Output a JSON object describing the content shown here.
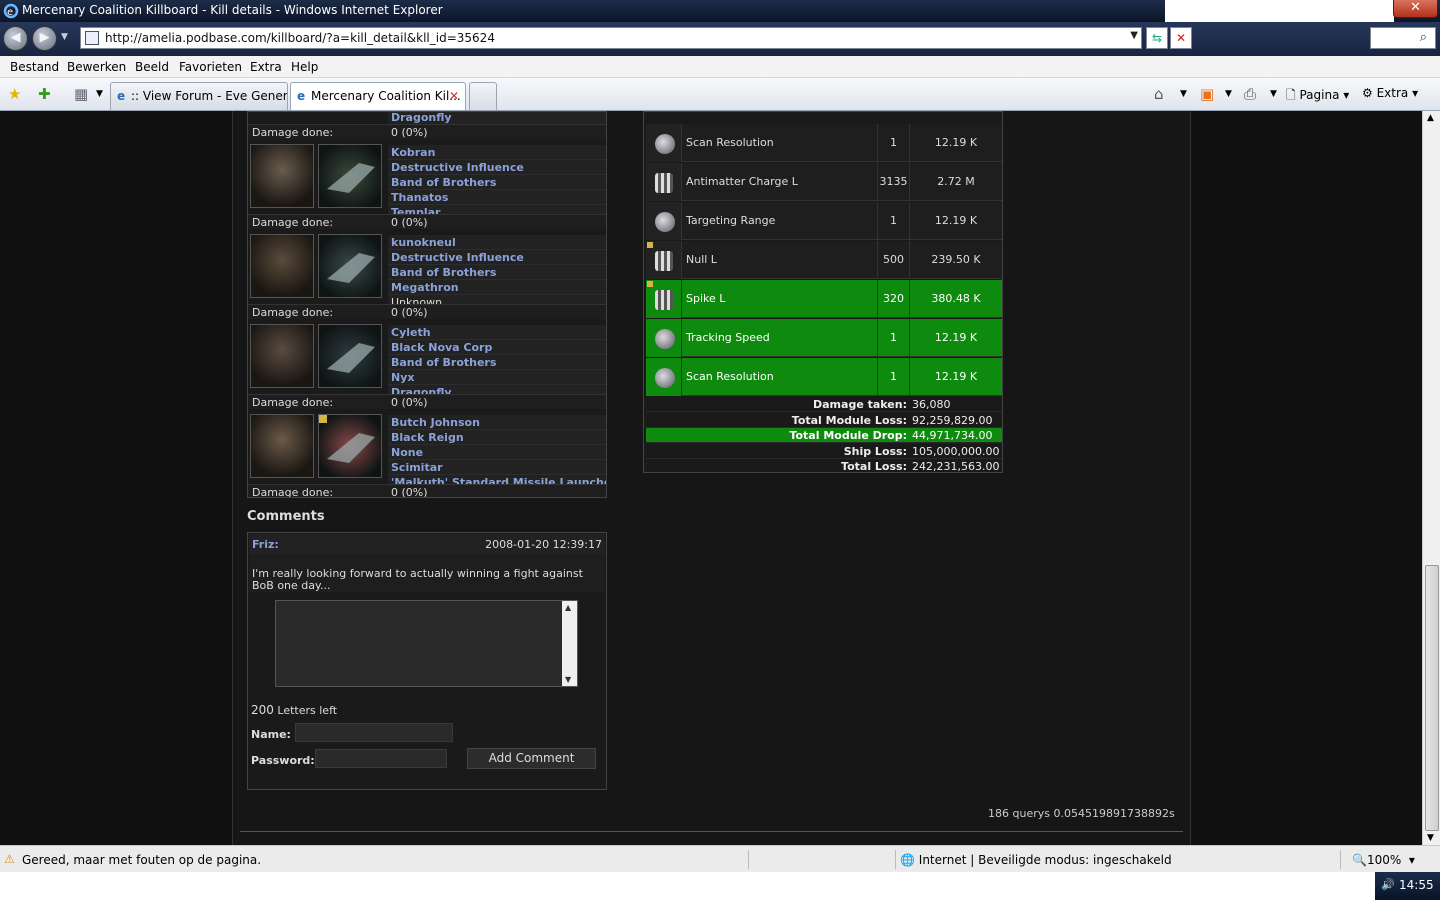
{
  "window": {
    "title": "Mercenary Coalition Killboard - Kill details - Windows Internet Explorer",
    "close": "✕"
  },
  "address": {
    "url": "http://amelia.podbase.com/killboard/?a=kill_detail&kll_id=35624"
  },
  "menu": [
    "Bestand",
    "Bewerken",
    "Beeld",
    "Favorieten",
    "Extra",
    "Help"
  ],
  "tabs": [
    {
      "label": ":: View Forum - Eve General"
    },
    {
      "label": "Mercenary Coalition Kil..."
    }
  ],
  "commands": {
    "page": "Pagina",
    "extra": "Extra"
  },
  "involved": {
    "damage_label": "Damage done:",
    "top_partial": {
      "ship": "Dragonfly",
      "damage": "0 (0%)"
    },
    "parties": [
      {
        "lines": [
          "Kobran",
          "Destructive Influence",
          "Band of Brothers",
          "Thanatos",
          "Templar"
        ],
        "damage": "0 (0%)"
      },
      {
        "lines": [
          "kunokneul",
          "Destructive Influence",
          "Band of Brothers",
          "Megathron",
          "Unknown"
        ],
        "damage": "0 (0%)"
      },
      {
        "lines": [
          "Cyleth",
          "Black Nova Corp",
          "Band of Brothers",
          "Nyx",
          "Dragonfly"
        ],
        "damage": "0 (0%)"
      },
      {
        "lines": [
          "Butch Johnson",
          "Black Reign",
          "None",
          "Scimitar",
          "'Malkuth' Standard Missile Launcher I"
        ],
        "damage": "0 (0%)"
      }
    ]
  },
  "comments": {
    "heading": "Comments",
    "author": "Friz:",
    "date": "2008-01-20 12:39:17",
    "text": "I'm really looking forward to actually winning a fight against BoB one day...",
    "letters_count": "200",
    "letters_label": " Letters left",
    "name_label": "Name:",
    "password_label": "Password:",
    "add_button": "Add Comment"
  },
  "loot": {
    "items": [
      {
        "name": "Scan Resolution",
        "qty": "1",
        "value": "12.19 K",
        "dropped": false,
        "icon": "scan-module-icon"
      },
      {
        "name": "Antimatter Charge L",
        "qty": "3135",
        "value": "2.72 M",
        "dropped": false,
        "icon": "charge-icon"
      },
      {
        "name": "Targeting Range",
        "qty": "1",
        "value": "12.19 K",
        "dropped": false,
        "icon": "scan-module-icon"
      },
      {
        "name": "Null L",
        "qty": "500",
        "value": "239.50 K",
        "dropped": false,
        "icon": "charge-icon"
      },
      {
        "name": "Spike L",
        "qty": "320",
        "value": "380.48 K",
        "dropped": true,
        "icon": "charge-icon"
      },
      {
        "name": "Tracking Speed",
        "qty": "1",
        "value": "12.19 K",
        "dropped": true,
        "icon": "script-icon"
      },
      {
        "name": "Scan Resolution",
        "qty": "1",
        "value": "12.19 K",
        "dropped": true,
        "icon": "scan-module-icon"
      }
    ],
    "summary": [
      {
        "label": "Damage taken:",
        "value": "36,080"
      },
      {
        "label": "Total Module Loss:",
        "value": "92,259,829.00"
      },
      {
        "label": "Total Module Drop:",
        "value": "44,971,734.00"
      },
      {
        "label": "Ship Loss:",
        "value": "105,000,000.00"
      },
      {
        "label": "Total Loss:",
        "value": "242,231,563.00"
      }
    ]
  },
  "footer": {
    "queries": "186 querys 0.054519891738892s"
  },
  "status": {
    "message": "Gereed, maar met fouten op de pagina.",
    "zone": "Internet | Beveiligde modus: ingeschakeld",
    "zoom": "100%"
  },
  "tray": {
    "time": "14:55"
  },
  "colors": {
    "drop_green": "#0e8a0e",
    "link_blue": "#8aa2d8",
    "page_bg": "#161616"
  }
}
